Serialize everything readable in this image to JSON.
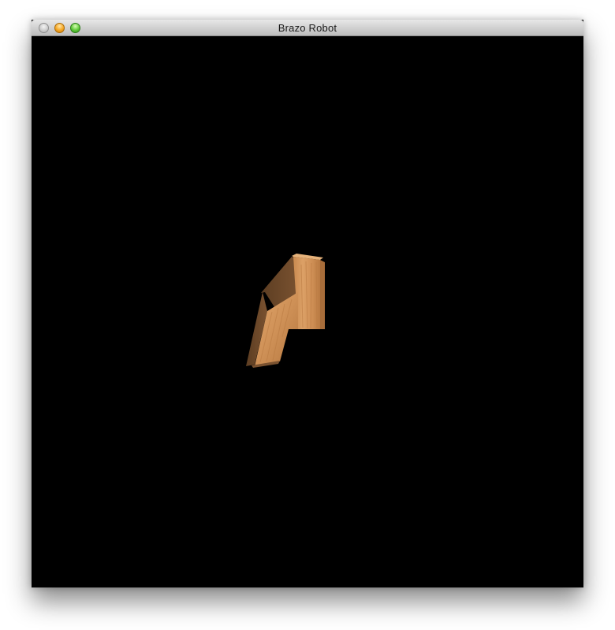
{
  "window": {
    "title": "Brazo Robot",
    "controls": [
      "close",
      "minimize",
      "zoom"
    ]
  },
  "scene": {
    "background_color": "#000000",
    "object": "robot-arm",
    "material": "wood",
    "colors": {
      "wood_light": "#d79a5e",
      "wood_mid": "#c98a4f",
      "wood_dark": "#6e4a2a",
      "wood_grain": "#b97a42"
    }
  }
}
